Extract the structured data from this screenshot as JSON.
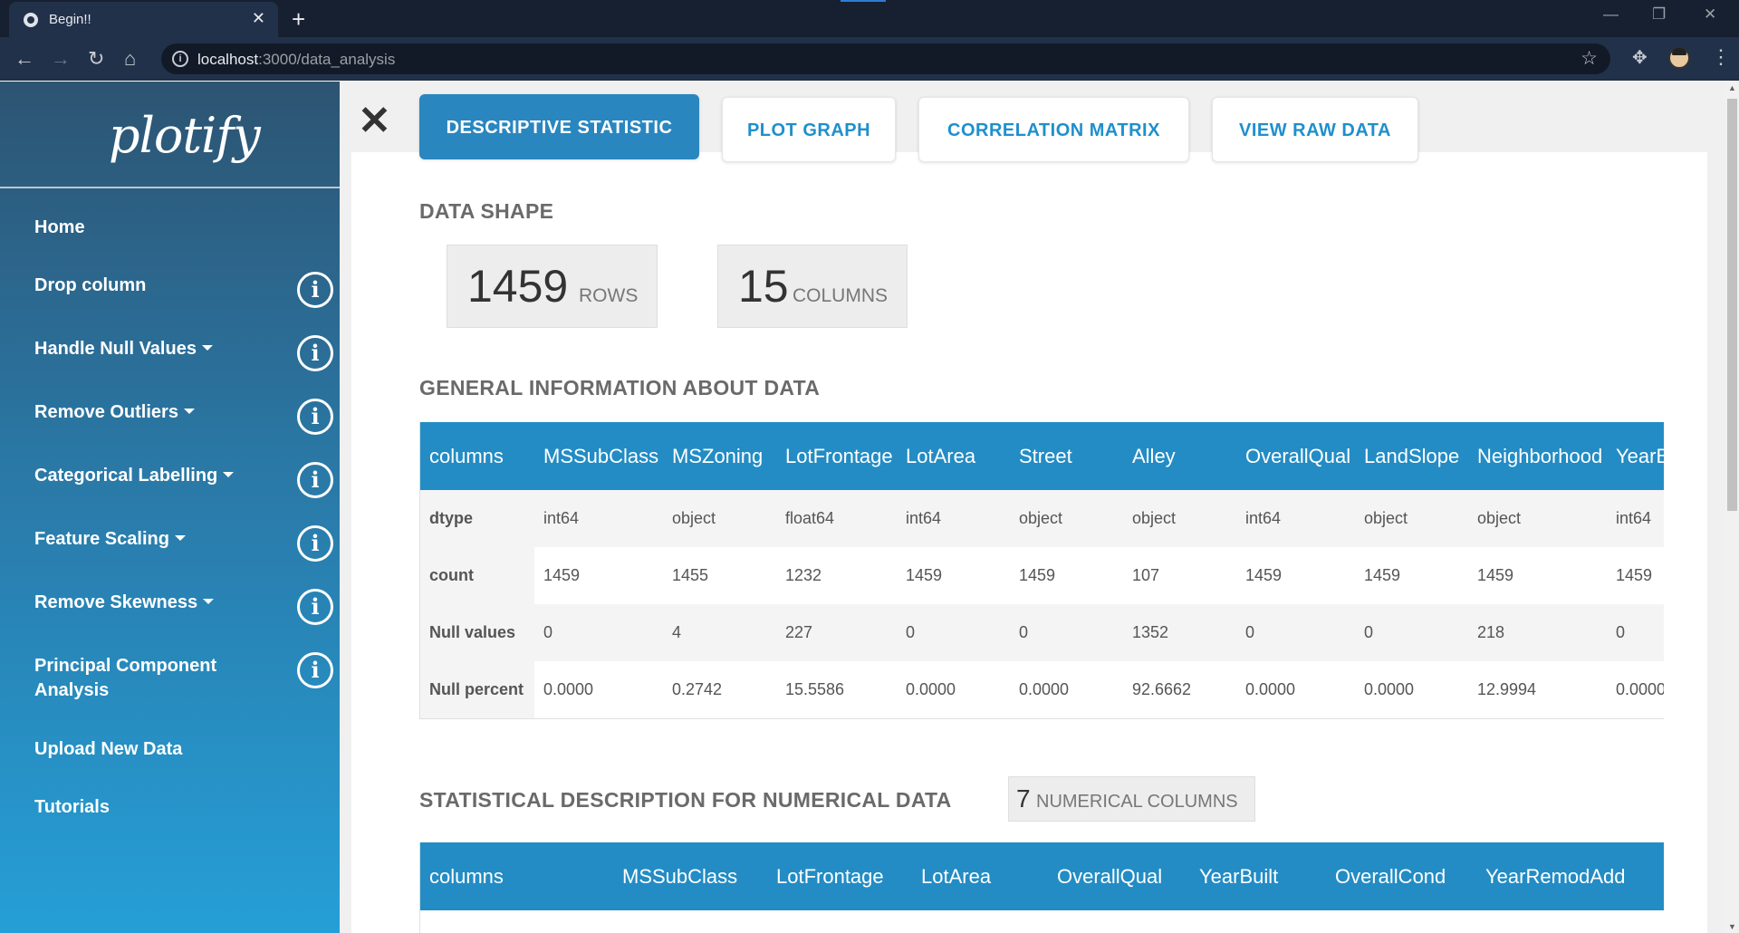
{
  "browser": {
    "tab_title": "Begin!!",
    "url_host": "localhost",
    "url_path": ":3000/data_analysis"
  },
  "sidebar": {
    "logo": "plotify",
    "items": [
      {
        "label": "Home",
        "has_info": false,
        "has_caret": false
      },
      {
        "label": "Drop column",
        "has_info": true,
        "has_caret": false
      },
      {
        "label": "Handle Null Values",
        "has_info": true,
        "has_caret": true
      },
      {
        "label": "Remove Outliers",
        "has_info": true,
        "has_caret": true
      },
      {
        "label": "Categorical Labelling",
        "has_info": true,
        "has_caret": true
      },
      {
        "label": "Feature Scaling",
        "has_info": true,
        "has_caret": true
      },
      {
        "label": "Remove Skewness",
        "has_info": true,
        "has_caret": true
      },
      {
        "label": "Principal Component",
        "label2": "Analysis",
        "has_info": true,
        "has_caret": false
      },
      {
        "label": "Upload New Data",
        "has_info": false,
        "has_caret": false
      },
      {
        "label": "Tutorials",
        "has_info": false,
        "has_caret": false
      }
    ]
  },
  "tabs": [
    {
      "label": "DESCRIPTIVE STATISTIC",
      "active": true
    },
    {
      "label": "PLOT GRAPH",
      "active": false
    },
    {
      "label": "CORRELATION MATRIX",
      "active": false
    },
    {
      "label": "VIEW RAW DATA",
      "active": false
    }
  ],
  "data_shape": {
    "title": "DATA SHAPE",
    "rows": "1459",
    "rows_label": "ROWS",
    "columns": "15",
    "columns_label": "COLUMNS"
  },
  "general_info": {
    "title": "GENERAL INFORMATION ABOUT DATA",
    "headers": [
      "columns",
      "MSSubClass",
      "MSZoning",
      "LotFrontage",
      "LotArea",
      "Street",
      "Alley",
      "OverallQual",
      "LandSlope",
      "Neighborhood",
      "YearBuilt"
    ],
    "rows": [
      [
        "dtype",
        "int64",
        "object",
        "float64",
        "int64",
        "object",
        "object",
        "int64",
        "object",
        "object",
        "int64"
      ],
      [
        "count",
        "1459",
        "1455",
        "1232",
        "1459",
        "1459",
        "107",
        "1459",
        "1459",
        "1459",
        "1459"
      ],
      [
        "Null values",
        "0",
        "4",
        "227",
        "0",
        "0",
        "1352",
        "0",
        "0",
        "218",
        "0"
      ],
      [
        "Null percent",
        "0.0000",
        "0.2742",
        "15.5586",
        "0.0000",
        "0.0000",
        "92.6662",
        "0.0000",
        "0.0000",
        "12.9994",
        "0.0000"
      ]
    ]
  },
  "numerical": {
    "title": "STATISTICAL DESCRIPTION FOR NUMERICAL DATA",
    "count": "7",
    "count_label": "NUMERICAL COLUMNS",
    "headers": [
      "columns",
      "MSSubClass",
      "LotFrontage",
      "LotArea",
      "OverallQual",
      "YearBuilt",
      "OverallCond",
      "YearRemodAdd"
    ]
  },
  "colors": {
    "sidebar_top": "#2d5472",
    "sidebar_bottom": "#259fd7",
    "table_header": "#238cc4",
    "tab_text": "#1f8fcd",
    "active_tab": "#2a86bf"
  }
}
